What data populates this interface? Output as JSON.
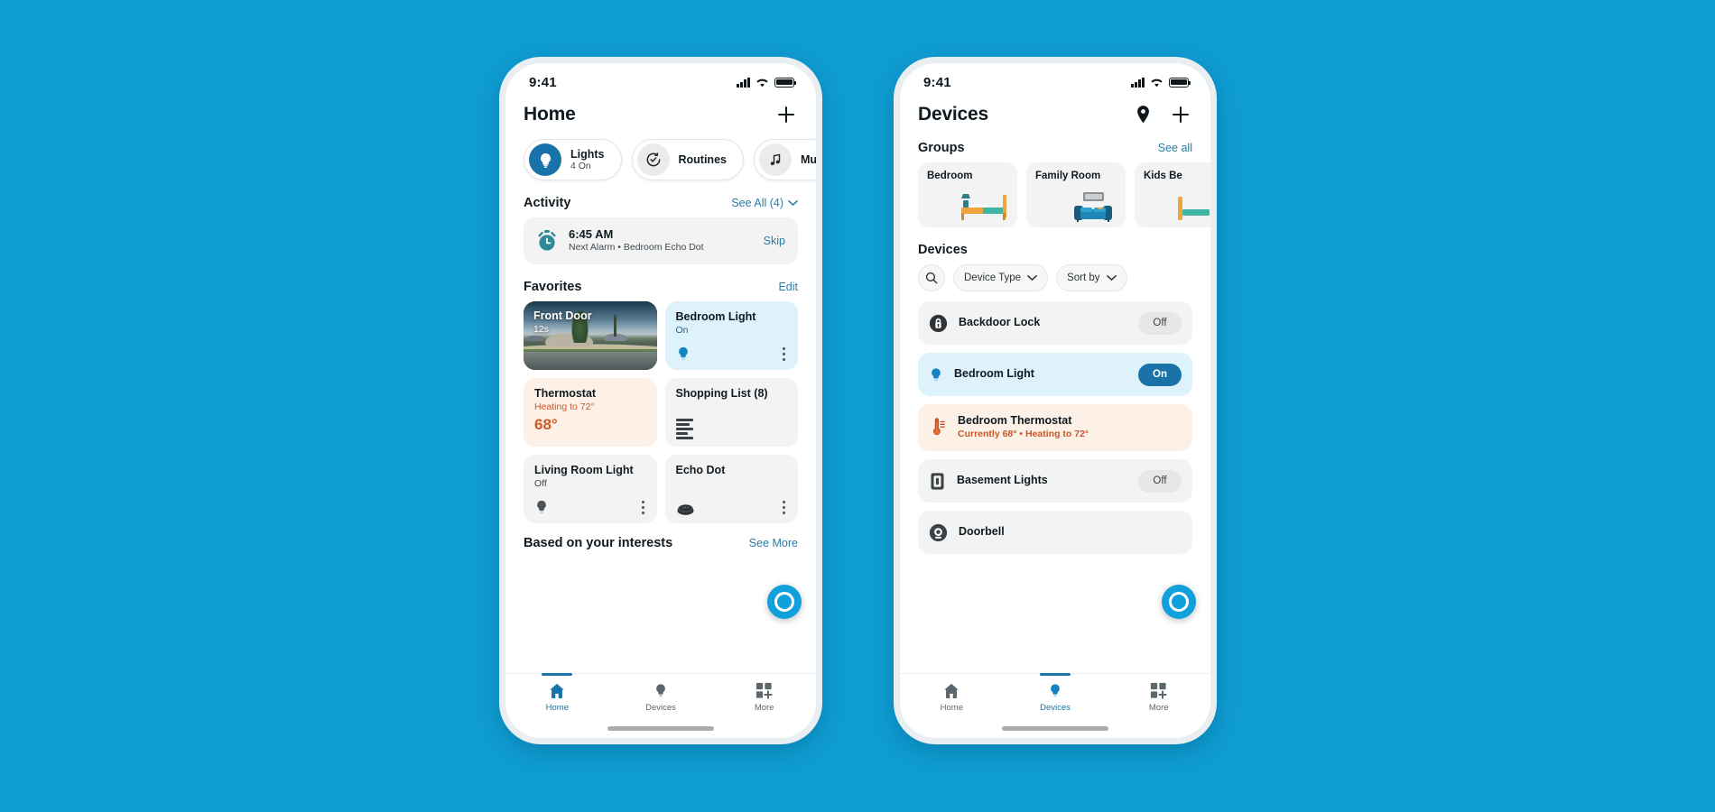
{
  "background_color": "#0e9cd3",
  "accent_color": "#1a73a8",
  "link_color": "#2a7ca8",
  "phone_home": {
    "status": {
      "time": "9:41"
    },
    "header": {
      "title": "Home",
      "add_label": "+"
    },
    "chips": [
      {
        "label": "Lights",
        "sub": "4 On",
        "icon": "bulb-icon",
        "active": true
      },
      {
        "label": "Routines",
        "sub": "",
        "icon": "routines-icon",
        "active": false
      },
      {
        "label": "Mu",
        "sub": "",
        "icon": "music-icon",
        "active": false
      }
    ],
    "activity": {
      "title": "Activity",
      "see_all": "See All (4)",
      "item": {
        "time": "6:45 AM",
        "detail": "Next Alarm • Bedroom Echo Dot",
        "action": "Skip",
        "icon": "alarm-clock-icon"
      }
    },
    "favorites": {
      "title": "Favorites",
      "edit": "Edit",
      "cards": [
        {
          "name": "Front Door",
          "sub": "12s",
          "type": "camera"
        },
        {
          "name": "Bedroom Light",
          "sub": "On",
          "type": "light-on",
          "icon": "bulb-icon"
        },
        {
          "name": "Thermostat",
          "sub": "Heating to 72°",
          "value": "68°",
          "type": "thermostat"
        },
        {
          "name": "Shopping List (8)",
          "sub": "",
          "type": "list",
          "icon": "list-icon"
        },
        {
          "name": "Living Room Light",
          "sub": "Off",
          "type": "light-off",
          "icon": "bulb-icon"
        },
        {
          "name": "Echo Dot",
          "sub": "",
          "type": "speaker",
          "icon": "echo-dot-icon"
        }
      ]
    },
    "interests": {
      "title": "Based on your interests",
      "see_more": "See More"
    },
    "fab": {
      "name": "alexa-button"
    },
    "tabs": [
      {
        "label": "Home",
        "icon": "home-icon",
        "active": true
      },
      {
        "label": "Devices",
        "icon": "bulb-icon",
        "active": false
      },
      {
        "label": "More",
        "icon": "grid-plus-icon",
        "active": false
      }
    ]
  },
  "phone_devices": {
    "status": {
      "time": "9:41"
    },
    "header": {
      "title": "Devices",
      "map_icon": "map-pin-icon",
      "add_label": "+"
    },
    "groups": {
      "title": "Groups",
      "see_all": "See all",
      "cards": [
        {
          "name": "Bedroom",
          "art": "bed-icon"
        },
        {
          "name": "Family Room",
          "art": "sofa-tv-icon"
        },
        {
          "name": "Kids Be",
          "art": "kids-bedroom-icon"
        }
      ]
    },
    "devices": {
      "title": "Devices",
      "filters": [
        {
          "label": "",
          "icon": "search-icon",
          "type": "round"
        },
        {
          "label": "Device Type",
          "icon": "chevron-down-icon",
          "type": "dropdown"
        },
        {
          "label": "Sort by",
          "icon": "chevron-down-icon",
          "type": "dropdown"
        }
      ],
      "rows": [
        {
          "name": "Backdoor Lock",
          "sub": "",
          "state": "Off",
          "state_on": false,
          "style": "plain",
          "icon": "lock-icon"
        },
        {
          "name": "Bedroom Light",
          "sub": "",
          "state": "On",
          "state_on": true,
          "style": "on",
          "icon": "bulb-icon"
        },
        {
          "name": "Bedroom Thermostat",
          "sub": "Currently 68° • Heating to 72°",
          "state": "",
          "state_on": false,
          "style": "warm",
          "icon": "thermometer-icon"
        },
        {
          "name": "Basement Lights",
          "sub": "",
          "state": "Off",
          "state_on": false,
          "style": "plain",
          "icon": "switch-icon"
        },
        {
          "name": "Doorbell",
          "sub": "",
          "state": "",
          "state_on": false,
          "style": "plain",
          "icon": "doorbell-icon"
        }
      ]
    },
    "fab": {
      "name": "alexa-button"
    },
    "tabs": [
      {
        "label": "Home",
        "icon": "home-icon",
        "active": false
      },
      {
        "label": "Devices",
        "icon": "bulb-icon",
        "active": true
      },
      {
        "label": "More",
        "icon": "grid-plus-icon",
        "active": false
      }
    ]
  }
}
